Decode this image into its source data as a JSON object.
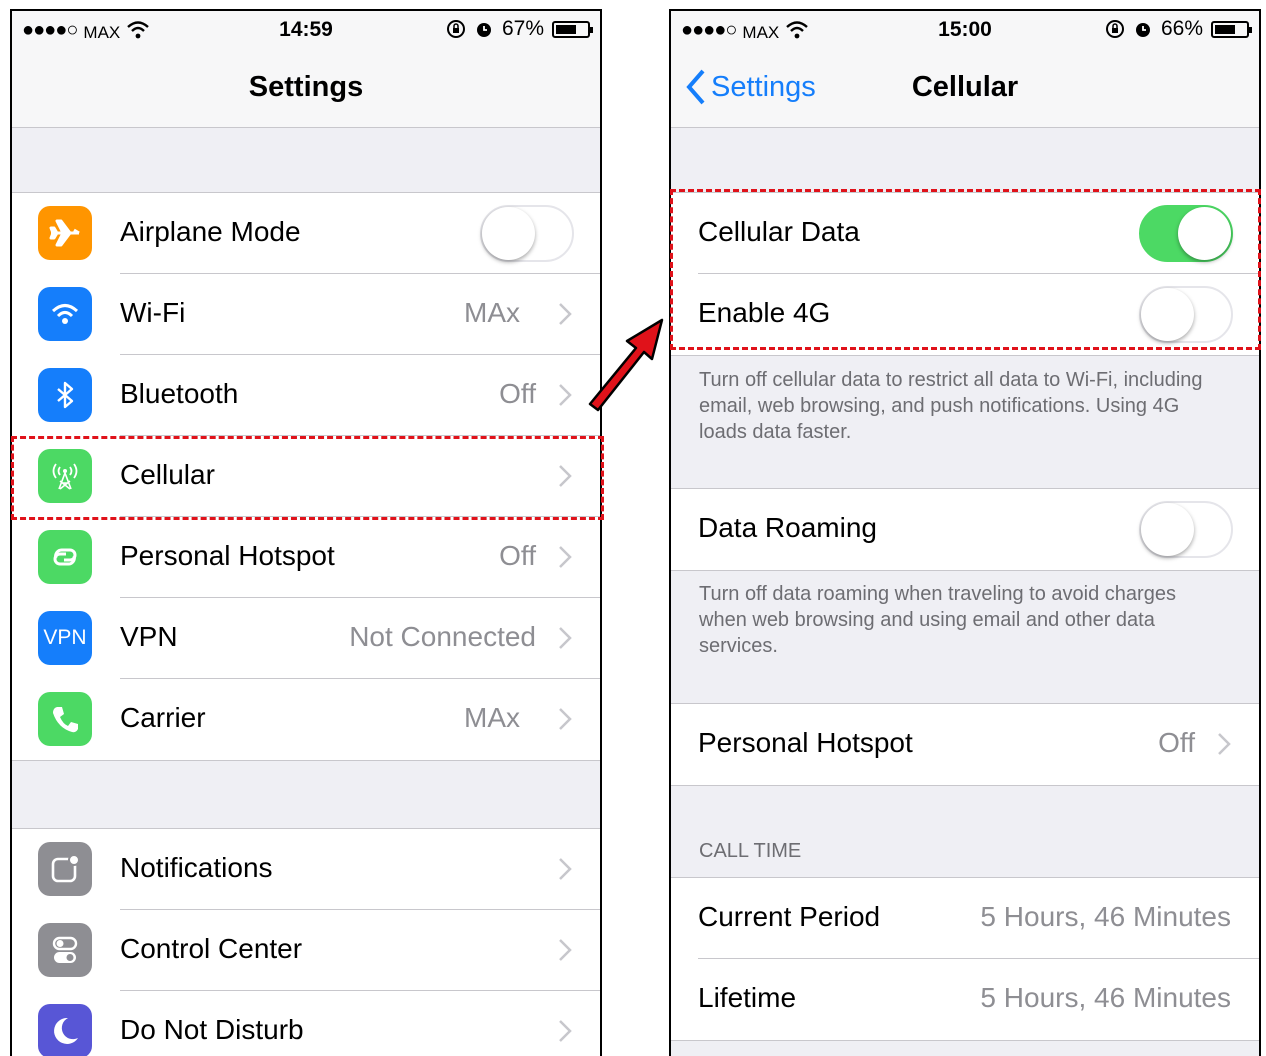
{
  "left": {
    "status": {
      "signal": "●●●●○",
      "carrier": "MAX",
      "time": "14:59",
      "battery_text": "67%",
      "battery_level": 0.67
    },
    "nav_title": "Settings",
    "group1": [
      {
        "label": "Airplane Mode",
        "icon": "airplane-icon",
        "color": "#ff9500",
        "toggle": false
      },
      {
        "label": "Wi-Fi",
        "icon": "wifi-icon",
        "color": "#157efb",
        "value": "MAx"
      },
      {
        "label": "Bluetooth",
        "icon": "bluetooth-icon",
        "color": "#157efb",
        "value": "Off"
      },
      {
        "label": "Cellular",
        "icon": "cellular-antenna-icon",
        "color": "#4cd964",
        "value": ""
      },
      {
        "label": "Personal Hotspot",
        "icon": "hotspot-icon",
        "color": "#4cd964",
        "value": "Off"
      },
      {
        "label": "VPN",
        "icon_text": "VPN",
        "icon": "vpn-icon",
        "color": "#157efb",
        "value": "Not Connected"
      },
      {
        "label": "Carrier",
        "icon": "phone-icon",
        "color": "#4cd964",
        "value": "MAx"
      }
    ],
    "group2": [
      {
        "label": "Notifications",
        "icon": "notifications-icon",
        "color": "#8e8e93"
      },
      {
        "label": "Control Center",
        "icon": "control-center-icon",
        "color": "#8e8e93"
      },
      {
        "label": "Do Not Disturb",
        "icon": "moon-icon",
        "color": "#5856d6"
      }
    ]
  },
  "right": {
    "status": {
      "signal": "●●●●○",
      "carrier": "MAX",
      "time": "15:00",
      "battery_text": "66%",
      "battery_level": 0.66
    },
    "back_label": "Settings",
    "nav_title": "Cellular",
    "cellular_data": {
      "label": "Cellular Data",
      "on": true
    },
    "enable_4g": {
      "label": "Enable 4G",
      "on": false
    },
    "footer1": "Turn off cellular data to restrict all data to Wi-Fi, including email, web browsing, and push notifications. Using 4G loads data faster.",
    "data_roaming": {
      "label": "Data Roaming",
      "on": false
    },
    "footer2": "Turn off data roaming when traveling to avoid charges when web browsing and using email and other data services.",
    "personal_hotspot": {
      "label": "Personal Hotspot",
      "value": "Off"
    },
    "call_time_header": "CALL TIME",
    "current_period": {
      "label": "Current Period",
      "value": "5 Hours, 46 Minutes"
    },
    "lifetime": {
      "label": "Lifetime",
      "value": "5 Hours, 46 Minutes"
    }
  },
  "colors": {
    "highlight": "#e0121a",
    "arrow": "#e0121a",
    "ios_blue": "#157efb",
    "ios_green": "#4cd964"
  }
}
